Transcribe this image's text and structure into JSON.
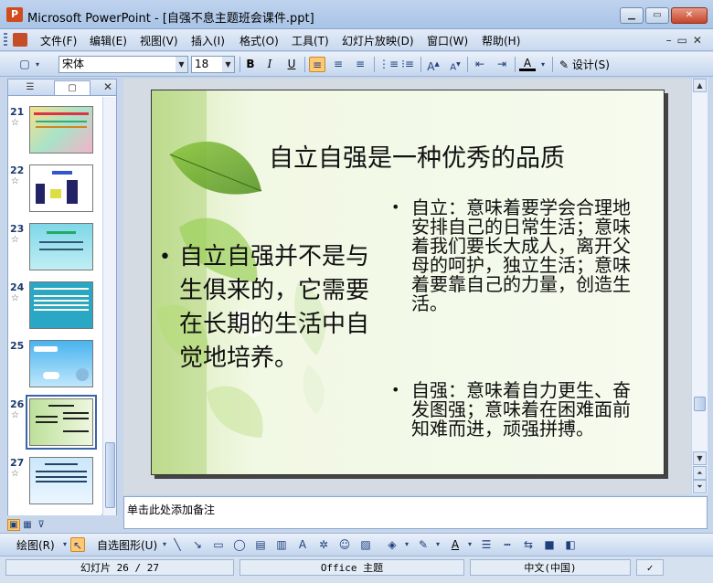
{
  "window": {
    "title": "Microsoft PowerPoint - [自强不息主题班会课件.ppt]",
    "app_icon": "powerpoint-icon"
  },
  "menu": {
    "items": [
      "文件(F)",
      "编辑(E)",
      "视图(V)",
      "插入(I)",
      "格式(O)",
      "工具(T)",
      "幻灯片放映(D)",
      "窗口(W)",
      "帮助(H)"
    ]
  },
  "toolbar": {
    "font_name": "宋体",
    "font_size": "18",
    "design_label": "设计(S)"
  },
  "slides_panel": {
    "slides": [
      {
        "number": "21"
      },
      {
        "number": "22"
      },
      {
        "number": "23"
      },
      {
        "number": "24"
      },
      {
        "number": "25"
      },
      {
        "number": "26",
        "selected": true
      },
      {
        "number": "27"
      }
    ]
  },
  "slide": {
    "title": "自立自强是一种优秀的品质",
    "left_bullet": "自立自强并不是与生俱来的，它需要在长期的生活中自觉地培养。",
    "right_bullet_1": "自立：意味着要学会合理地安排自己的日常生活；意味着我们要长大成人，离开父母的呵护，独立生活；意味着要靠自己的力量，创造生活。",
    "right_bullet_2": "自强：意味着自力更生、奋发图强；意味着在困难面前知难而进，顽强拼搏。"
  },
  "notes": {
    "placeholder": "单击此处添加备注"
  },
  "drawing_toolbar": {
    "draw_label": "绘图(R)",
    "autoshapes_label": "自选图形(U)"
  },
  "status": {
    "slide_counter": "幻灯片 26 / 27",
    "theme": "Office 主题",
    "language": "中文(中国)"
  },
  "colors": {
    "accent": "#3a64a8",
    "title_bar": "#bfd3ee",
    "slide_bg": "#f6fbef"
  }
}
